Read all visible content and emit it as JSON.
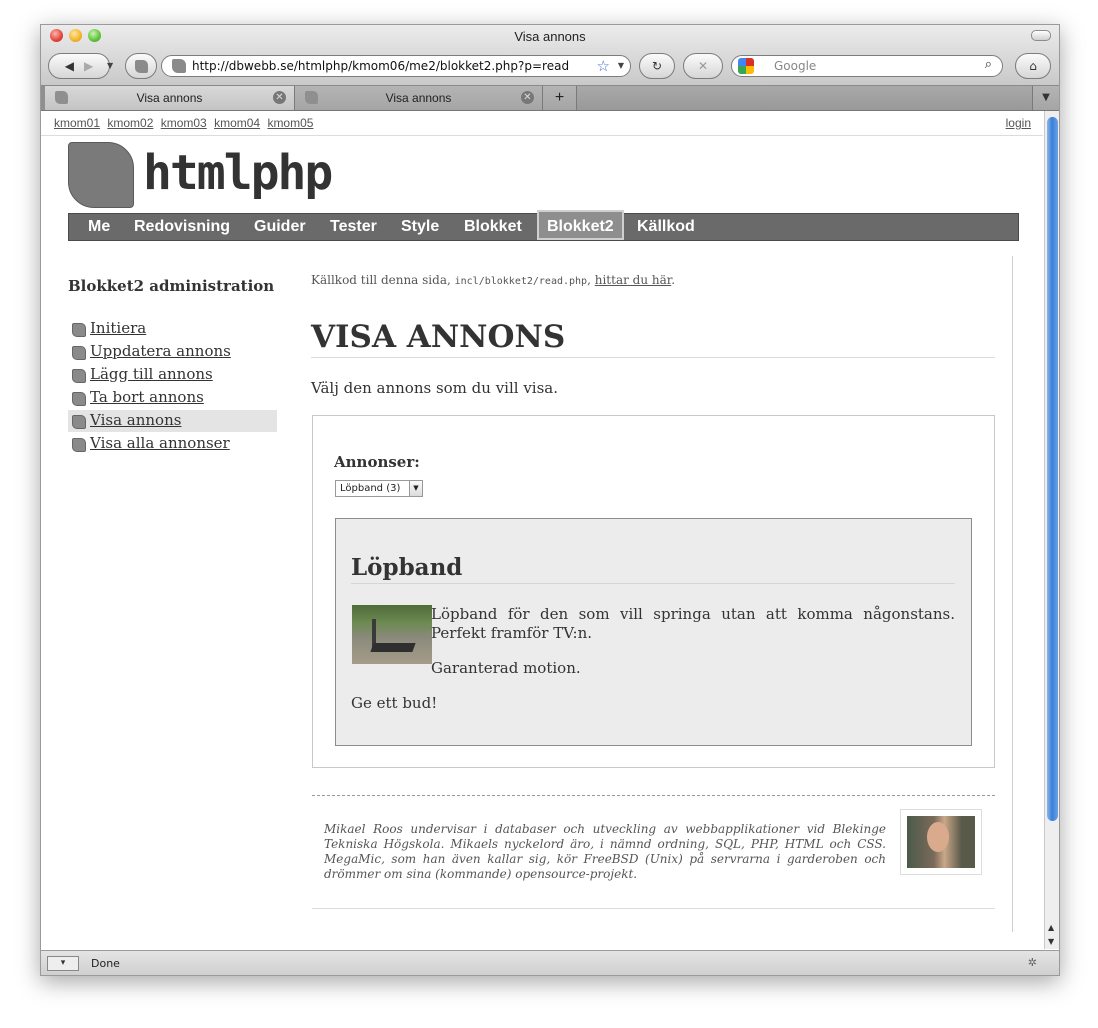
{
  "window": {
    "title": "Visa annons"
  },
  "toolbar": {
    "url": "http://dbwebb.se/htmlphp/kmom06/me2/blokket2.php?p=read",
    "search_placeholder": "Google"
  },
  "tabs": [
    {
      "label": "Visa annons",
      "active": true
    },
    {
      "label": "Visa annons",
      "active": false
    }
  ],
  "status": {
    "text": "Done"
  },
  "page": {
    "toplinks": [
      "kmom01",
      "kmom02",
      "kmom03",
      "kmom04",
      "kmom05"
    ],
    "login": "login",
    "logo": "htmlphp",
    "nav": [
      "Me",
      "Redovisning",
      "Guider",
      "Tester",
      "Style",
      "Blokket",
      "Blokket2",
      "Källkod"
    ],
    "nav_selected": "Blokket2",
    "sidebar": {
      "title": "Blokket2 administration",
      "items": [
        "Initiera",
        "Uppdatera annons",
        "Lägg till annons",
        "Ta bort annons",
        "Visa annons",
        "Visa alla annonser"
      ],
      "active": "Visa annons"
    },
    "source": {
      "prefix": "Källkod till denna sida,",
      "path": "incl/blokket2/read.php",
      "comma": ",",
      "link": "hittar du här",
      "suffix": "."
    },
    "heading": "VISA ANNONS",
    "intro": "Välj den annons som du vill visa.",
    "form": {
      "label": "Annonser:",
      "selected": "Löpband (3)"
    },
    "ad": {
      "title": "Löpband",
      "description": "Löpband för den som vill springa utan att komma någonstans. Perfekt framför TV:n.",
      "p2": "Garanterad motion.",
      "p3": "Ge ett bud!"
    },
    "footer": "Mikael Roos undervisar i databaser och utveckling av webbapplikationer vid Blekinge Tekniska Högskola. Mikaels nyckelord äro, i nämnd ordning, SQL, PHP, HTML och CSS. MegaMic, som han även kallar sig, kör FreeBSD (Unix) på servrarna i garderoben och drömmer om sina (kommande) opensource-projekt."
  }
}
